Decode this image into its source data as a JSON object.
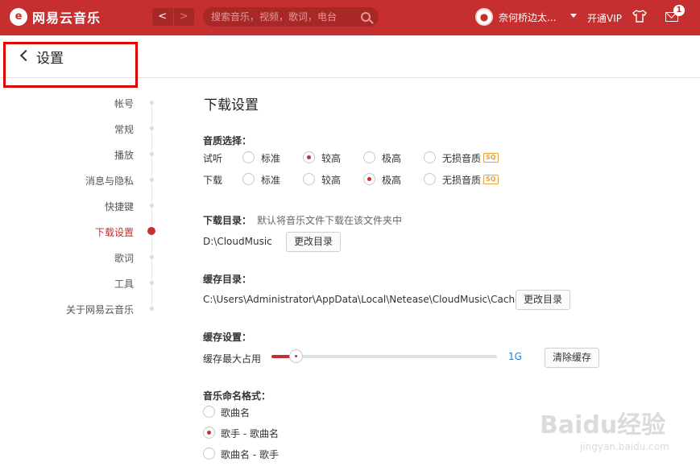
{
  "app": {
    "name": "网易云音乐",
    "logo_glyph": "e"
  },
  "topbar": {
    "back": "<",
    "forward": ">",
    "search_placeholder": "搜索音乐，视频，歌词，电台",
    "username": "奈何桥边太...",
    "vip": "开通VIP",
    "mail_badge": "1",
    "accent_color": "#c62f2f"
  },
  "header": {
    "title": "设置"
  },
  "sidebar": {
    "items": [
      {
        "label": "帐号",
        "active": false
      },
      {
        "label": "常规",
        "active": false
      },
      {
        "label": "播放",
        "active": false
      },
      {
        "label": "消息与隐私",
        "active": false
      },
      {
        "label": "快捷键",
        "active": false
      },
      {
        "label": "下载设置",
        "active": true
      },
      {
        "label": "歌词",
        "active": false
      },
      {
        "label": "工具",
        "active": false
      },
      {
        "label": "关于网易云音乐",
        "active": false
      }
    ]
  },
  "download": {
    "title": "下载设置",
    "quality": {
      "label": "音质选择：",
      "sq": "SQ",
      "rows": [
        {
          "label": "试听",
          "options": [
            "标准",
            "较高",
            "极高",
            "无损音质"
          ],
          "selected": 1
        },
        {
          "label": "下载",
          "options": [
            "标准",
            "较高",
            "极高",
            "无损音质"
          ],
          "selected": 2
        }
      ]
    },
    "dir": {
      "label": "下载目录：",
      "hint": "默认将音乐文件下载在该文件夹中",
      "path": "D:\\CloudMusic",
      "button": "更改目录"
    },
    "cache_dir": {
      "label": "缓存目录：",
      "path": "C:\\Users\\Administrator\\AppData\\Local\\Netease\\CloudMusic\\Cache",
      "button": "更改目录"
    },
    "cache": {
      "label": "缓存设置：",
      "max_label": "缓存最大占用",
      "value": "1G",
      "level": 0.08,
      "button": "清除缓存"
    },
    "naming": {
      "label": "音乐命名格式：",
      "options": [
        "歌曲名",
        "歌手 - 歌曲名",
        "歌曲名 - 歌手"
      ],
      "selected": 1
    }
  },
  "watermark": {
    "main": "Baidu经验",
    "sub": "jingyan.baidu.com"
  }
}
